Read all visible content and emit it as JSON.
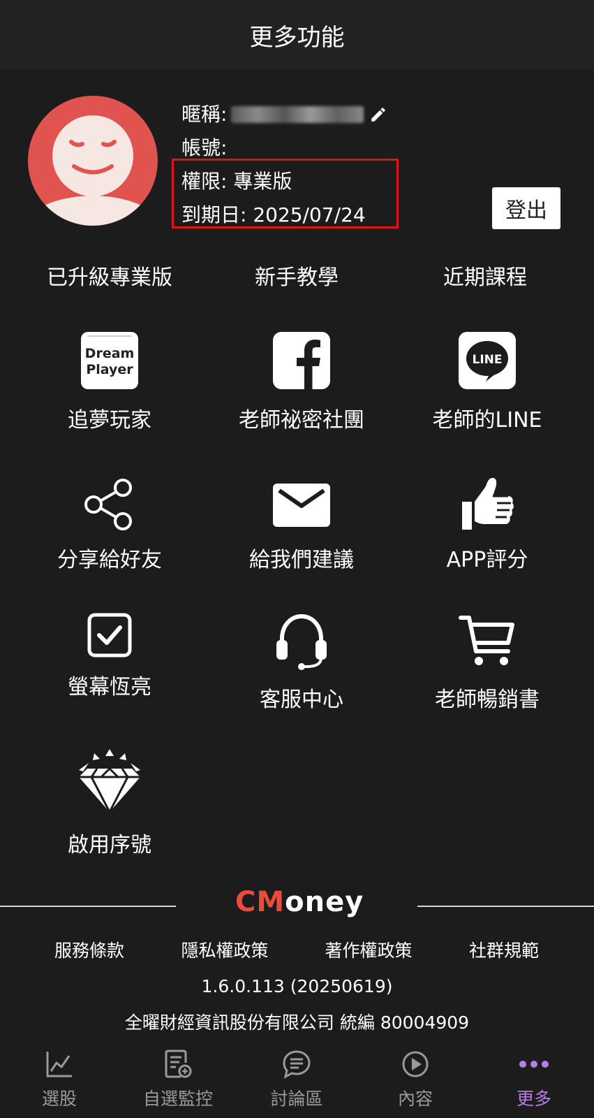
{
  "header": {
    "title": "更多功能"
  },
  "profile": {
    "nickname_label": "暱稱:",
    "account_label": "帳號:",
    "permission_text": "權限: 專業版",
    "expiry_text": "到期日: 2025/07/24",
    "logout_label": "登出"
  },
  "text_links": [
    "已升級專業版",
    "新手教學",
    "近期課程"
  ],
  "features": [
    {
      "label": "追夢玩家",
      "icon": "dream-player-icon",
      "icon_text_1": "Dream",
      "icon_text_2": "Player"
    },
    {
      "label": "老師祕密社團",
      "icon": "facebook-icon"
    },
    {
      "label": "老師的LINE",
      "icon": "line-icon",
      "icon_text": "LINE"
    },
    {
      "label": "分享給好友",
      "icon": "share-icon"
    },
    {
      "label": "給我們建議",
      "icon": "mail-icon"
    },
    {
      "label": "APP評分",
      "icon": "thumbs-up-icon"
    },
    {
      "label": "螢幕恆亮",
      "icon": "checkbox-icon"
    },
    {
      "label": "客服中心",
      "icon": "headset-icon"
    },
    {
      "label": "老師暢銷書",
      "icon": "cart-icon"
    },
    {
      "label": "啟用序號",
      "icon": "diamond-icon"
    }
  ],
  "footer": {
    "brand_cm": "CM",
    "brand_rest": "oney",
    "links": [
      "服務條款",
      "隱私權政策",
      "著作權政策",
      "社群規範"
    ],
    "version": "1.6.0.113 (20250619)",
    "company": "全曜財經資訊股份有限公司 統編 80004909"
  },
  "bottom_nav": [
    {
      "label": "選股",
      "icon": "chart-icon",
      "active": false
    },
    {
      "label": "自選監控",
      "icon": "watchlist-icon",
      "active": false
    },
    {
      "label": "討論區",
      "icon": "chat-icon",
      "active": false
    },
    {
      "label": "內容",
      "icon": "play-icon",
      "active": false
    },
    {
      "label": "更多",
      "icon": "more-dots-icon",
      "active": true
    }
  ],
  "colors": {
    "background": "#1c1c1c",
    "header": "#222222",
    "avatar": "#e0534e",
    "highlight_border": "#e2121a",
    "brand_red": "#ea4b3c",
    "nav_active": "#b77fe5",
    "nav_inactive": "#9a9a9a"
  }
}
